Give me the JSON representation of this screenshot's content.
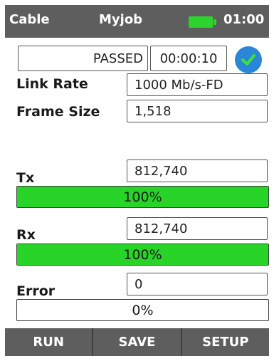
{
  "status_bar": {
    "cable": "Cable",
    "job": "Myjob",
    "time": "01:00",
    "battery_color": "#2ed42e"
  },
  "result": {
    "status": "PASSED",
    "elapsed": "00:00:10",
    "status_icon": "check-circle-icon"
  },
  "fields": {
    "link_rate_label": "Link Rate",
    "link_rate_value": "1000 Mb/s-FD",
    "frame_size_label": "Frame Size",
    "frame_size_value": "1,518"
  },
  "tx": {
    "label": "Tx",
    "value": "812,740",
    "percent_text": "100%",
    "fill_fraction": 1.0,
    "color": "#28d428"
  },
  "rx": {
    "label": "Rx",
    "value": "812,740",
    "percent_text": "100%",
    "fill_fraction": 1.0,
    "color": "#28d428"
  },
  "error": {
    "label": "Error",
    "value": "0",
    "percent_text": "0%",
    "fill_fraction": 0.0,
    "color": "#28d428"
  },
  "softkeys": {
    "run": "RUN",
    "save": "SAVE",
    "setup": "SETUP"
  }
}
